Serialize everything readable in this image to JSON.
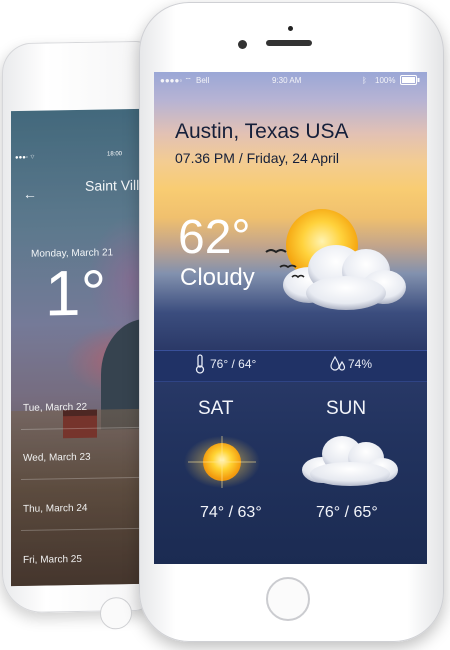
{
  "back_phone": {
    "status_time": "18:00",
    "city": "Saint Villa",
    "date": "Monday, March 21",
    "temperature": "1°",
    "days": [
      "Tue, March 22",
      "Wed, March 23",
      "Thu, March 24",
      "Fri, March 25"
    ]
  },
  "front_phone": {
    "status": {
      "carrier": "Bell",
      "time": "9:30 AM",
      "battery": "100%"
    },
    "location": "Austin, Texas USA",
    "datetime": "07.36 PM / Friday, 24 April",
    "current": {
      "temperature": "62°",
      "condition": "Cloudy"
    },
    "stats": {
      "high_low": "76° / 64°",
      "humidity": "74%"
    },
    "forecast": [
      {
        "day": "SAT",
        "temps": "74° / 63°",
        "icon": "sun-icon"
      },
      {
        "day": "SUN",
        "temps": "76° / 65°",
        "icon": "cloud-icon"
      }
    ]
  },
  "colors": {
    "sky_top": "#9aa7d6",
    "sky_mid": "#f8cc72",
    "panel": "#22335f",
    "text_dark": "#16203a"
  }
}
